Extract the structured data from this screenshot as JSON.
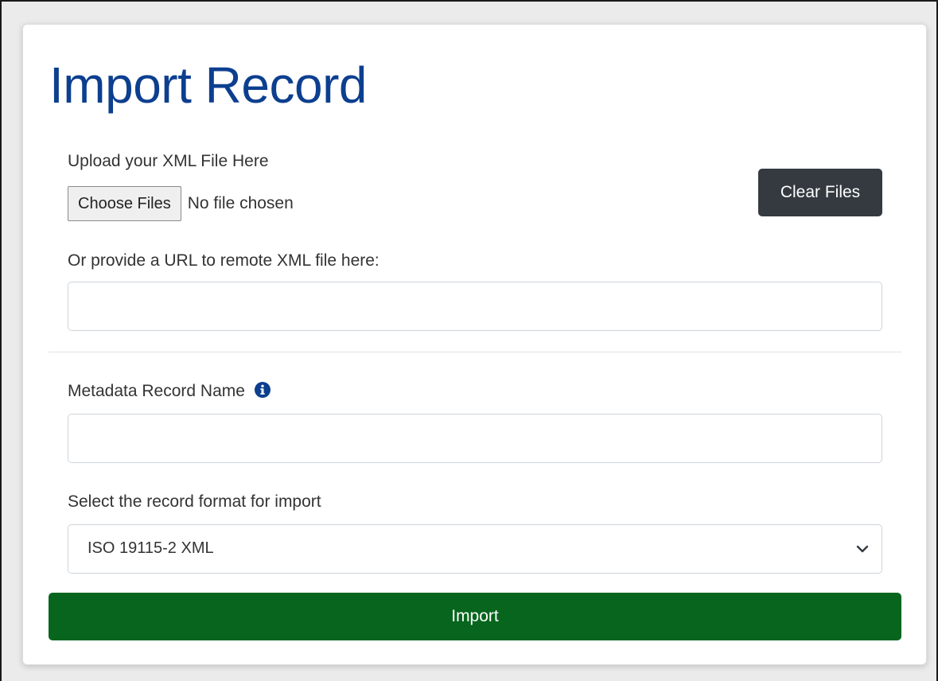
{
  "page": {
    "title": "Import Record"
  },
  "upload": {
    "label": "Upload your XML File Here",
    "choose_button_label": "Choose Files",
    "no_file_text": "No file chosen",
    "clear_button_label": "Clear Files"
  },
  "url": {
    "label": "Or provide a URL to remote XML file here:",
    "value": "",
    "placeholder": ""
  },
  "record_name": {
    "label": "Metadata Record Name",
    "info_icon": "info-circle-icon",
    "value": "",
    "placeholder": ""
  },
  "format": {
    "label": "Select the record format for import",
    "selected": "ISO 19115-2 XML",
    "icon": "chevron-down-icon"
  },
  "import_button_label": "Import",
  "colors": {
    "title": "#0d3f8f",
    "clear_button": "#343a40",
    "import_button": "#07651d",
    "info_icon": "#0d3f8f"
  }
}
